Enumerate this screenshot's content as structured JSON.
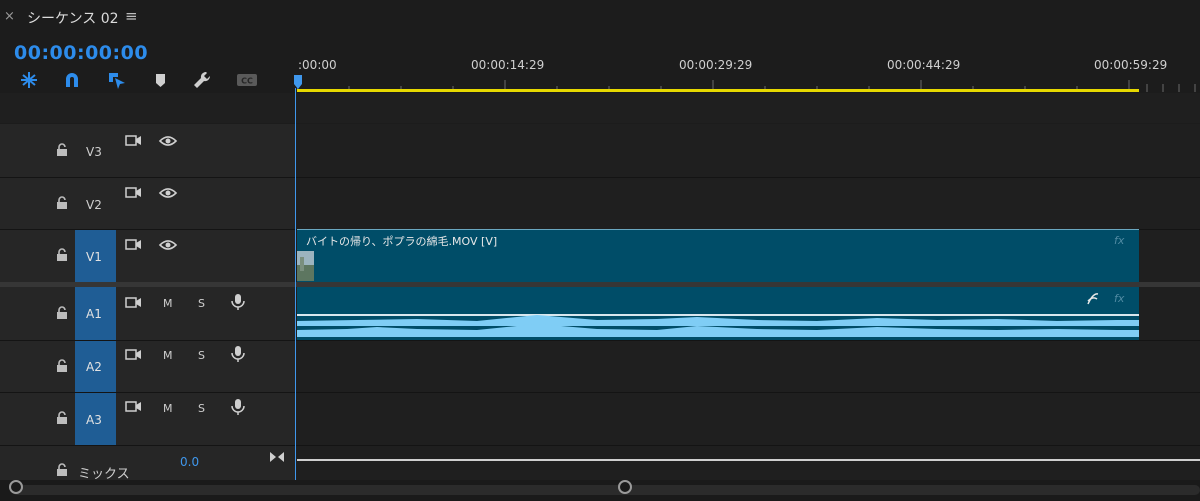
{
  "tab": {
    "close": "×",
    "title": "シーケンス 02",
    "menu": "≡"
  },
  "timecode": "00:00:00:00",
  "toolbar": [
    {
      "name": "snap-icon"
    },
    {
      "name": "magnet-icon"
    },
    {
      "name": "linked-selection-icon"
    },
    {
      "name": "marker-icon"
    },
    {
      "name": "wrench-icon"
    },
    {
      "name": "captions-icon"
    }
  ],
  "ruler": {
    "labels": [
      ":00:00",
      "00:00:14:29",
      "00:00:29:29",
      "00:00:44:29",
      "00:00:59:29"
    ]
  },
  "tracks": {
    "v3": {
      "name": "V3"
    },
    "v2": {
      "name": "V2"
    },
    "v1": {
      "name": "V1"
    },
    "a1": {
      "name": "A1",
      "mute": "M",
      "solo": "S"
    },
    "a2": {
      "name": "A2",
      "mute": "M",
      "solo": "S"
    },
    "a3": {
      "name": "A3",
      "mute": "M",
      "solo": "S"
    }
  },
  "clips": {
    "video": {
      "title": "バイトの帰り、ポプラの綿毛.MOV [V]",
      "fx": "fx"
    },
    "audio": {
      "fx": "fx"
    }
  },
  "mix": {
    "label": "ミックス",
    "value": "0.0"
  },
  "colors": {
    "accent": "#2d8ceb",
    "clip": "#004d68",
    "waveform": "#7fcdf5",
    "work_area": "#e6d800",
    "selected_track": "#1f5d95"
  }
}
